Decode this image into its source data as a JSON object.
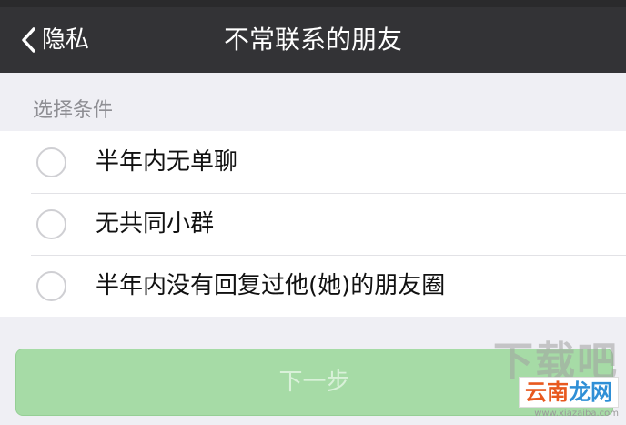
{
  "nav": {
    "back_label": "隐私",
    "title": "不常联系的朋友"
  },
  "section": {
    "header": "选择条件"
  },
  "options": [
    {
      "label": "半年内无单聊",
      "selected": false
    },
    {
      "label": "无共同小群",
      "selected": false
    },
    {
      "label": "半年内没有回复过他(她)的朋友圈",
      "selected": false
    }
  ],
  "next_button": {
    "label": "下一步",
    "enabled": false
  },
  "watermark": {
    "big_text": "下载吧",
    "brand_part1": "云南",
    "brand_part2": "龙网",
    "url": "www.xiazaiba.com"
  },
  "colors": {
    "nav_background": "#333336",
    "page_background": "#efeff4",
    "button_disabled_green": "#a6dba6",
    "radio_border": "#cfcfd3"
  },
  "icons": {
    "back": "chevron-left-icon"
  }
}
